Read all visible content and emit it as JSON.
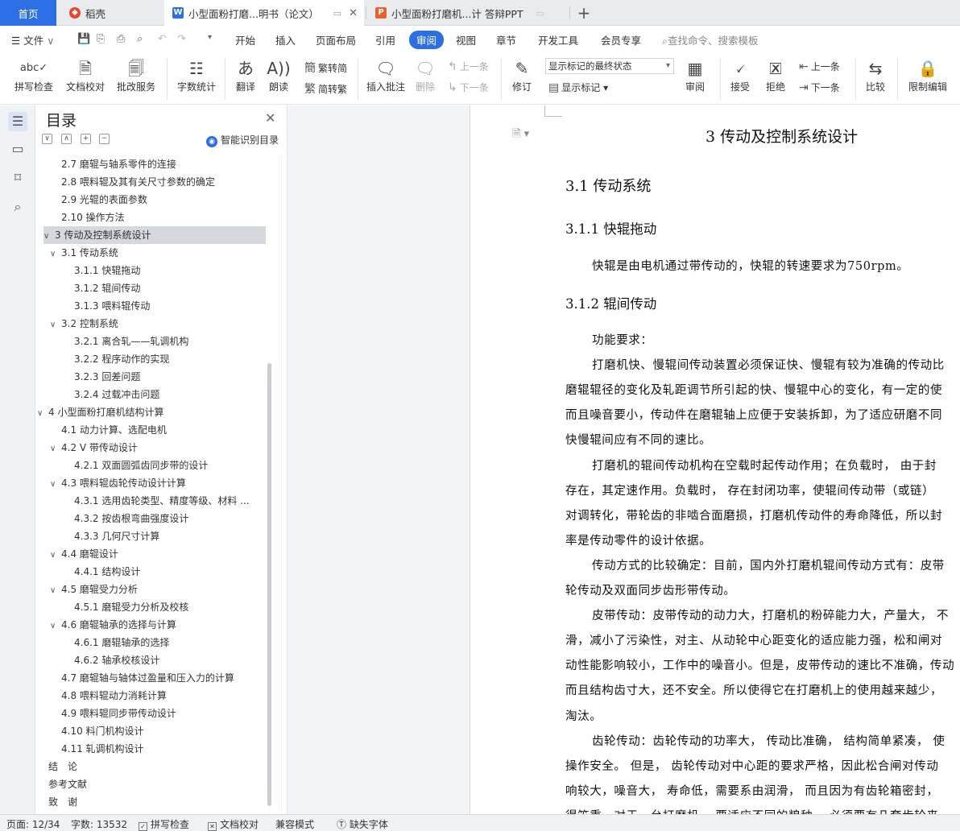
{
  "tabs": {
    "home": "首页",
    "docer": "稻壳",
    "doc_active": "小型面粉打磨...明书（论文）",
    "ppt": "小型面粉打磨机...计 答辩PPT",
    "plus": "+"
  },
  "menu": {
    "file": "文件",
    "items": [
      "开始",
      "插入",
      "页面布局",
      "引用",
      "审阅",
      "视图",
      "章节",
      "开发工具",
      "会员专享"
    ],
    "search": "查找命令、搜索模板"
  },
  "ribbon": {
    "spell": "拼写检查",
    "proofread": "文档校对",
    "annotate_service": "批改服务",
    "word_count": "字数统计",
    "translate": "翻译",
    "read_aloud": "朗读",
    "trad": "繁转简",
    "simp": "简转繁",
    "insert_comment": "插入批注",
    "delete": "删除",
    "prev": "上一条",
    "next": "下一条",
    "revise": "修订",
    "mark_state": "显示标记的最终状态",
    "show_marks": "显示标记",
    "review": "审阅",
    "accept": "接受",
    "reject": "拒绝",
    "prev2": "上一条",
    "next2": "下一条",
    "compare": "比较",
    "restrict": "限制编辑"
  },
  "toc": {
    "title": "目录",
    "smart": "智能识别目录",
    "items": [
      {
        "text": "2.7 磨辊与轴系零件的连接",
        "level": 2,
        "caret": ""
      },
      {
        "text": "2.8 喂料辊及其有关尺寸参数的确定",
        "level": 2,
        "caret": ""
      },
      {
        "text": "2.9 光辊的表面参数",
        "level": 2,
        "caret": ""
      },
      {
        "text": "2.10 操作方法",
        "level": 2,
        "caret": ""
      },
      {
        "text": "3 传动及控制系统设计",
        "level": 1,
        "caret": "∨",
        "sel": true
      },
      {
        "text": "3.1 传动系统",
        "level": 2,
        "caret": "∨"
      },
      {
        "text": "3.1.1 快辊拖动",
        "level": 3,
        "caret": ""
      },
      {
        "text": "3.1.2 辊间传动",
        "level": 3,
        "caret": ""
      },
      {
        "text": "3.1.3 喂料辊传动",
        "level": 3,
        "caret": ""
      },
      {
        "text": "3.2 控制系统",
        "level": 2,
        "caret": "∨"
      },
      {
        "text": "3.2.1 离合轧——轧调机构",
        "level": 3,
        "caret": ""
      },
      {
        "text": "3.2.2 程序动作的实现",
        "level": 3,
        "caret": ""
      },
      {
        "text": "3.2.3 回差问题",
        "level": 3,
        "caret": ""
      },
      {
        "text": "3.2.4 过载冲击问题",
        "level": 3,
        "caret": ""
      },
      {
        "text": "4 小型面粉打磨机结构计算",
        "level": 1,
        "caret": "∨"
      },
      {
        "text": "4.1 动力计算、选配电机",
        "level": 2,
        "caret": ""
      },
      {
        "text": "4.2 V 带传动设计",
        "level": 2,
        "caret": "∨"
      },
      {
        "text": "4.2.1 双面圆弧齿同步带的设计",
        "level": 3,
        "caret": ""
      },
      {
        "text": "4.3 喂料辊齿轮传动设计计算",
        "level": 2,
        "caret": "∨"
      },
      {
        "text": "4.3.1 选用齿轮类型、精度等级、材料 ...",
        "level": 3,
        "caret": ""
      },
      {
        "text": "4.3.2 按齿根弯曲强度设计",
        "level": 3,
        "caret": ""
      },
      {
        "text": "4.3.3 几何尺寸计算",
        "level": 3,
        "caret": ""
      },
      {
        "text": "4.4 磨辊设计",
        "level": 2,
        "caret": "∨"
      },
      {
        "text": "4.4.1 结构设计",
        "level": 3,
        "caret": ""
      },
      {
        "text": "4.5 磨辊受力分析",
        "level": 2,
        "caret": "∨"
      },
      {
        "text": "4.5.1 磨辊受力分析及校核",
        "level": 3,
        "caret": ""
      },
      {
        "text": "4.6 磨辊轴承的选择与计算",
        "level": 2,
        "caret": "∨"
      },
      {
        "text": "4.6.1 磨辊轴承的选择",
        "level": 3,
        "caret": ""
      },
      {
        "text": "4.6.2 轴承校核设计",
        "level": 3,
        "caret": ""
      },
      {
        "text": "4.7 磨辊轴与轴体过盈量和压入力的计算",
        "level": 2,
        "caret": ""
      },
      {
        "text": "4.8 喂料辊动力消耗计算",
        "level": 2,
        "caret": ""
      },
      {
        "text": "4.9 喂料辊同步带传动设计",
        "level": 2,
        "caret": ""
      },
      {
        "text": "4.10 料门机构设计",
        "level": 2,
        "caret": ""
      },
      {
        "text": "4.11 轧调机构设计",
        "level": 2,
        "caret": ""
      },
      {
        "text": "结　论",
        "level": 1,
        "caret": ""
      },
      {
        "text": "参考文献",
        "level": 1,
        "caret": ""
      },
      {
        "text": "致　谢",
        "level": 1,
        "caret": ""
      }
    ]
  },
  "doc": {
    "chapter_title": "3 传动及控制系统设计",
    "sec_31": "3.1 传动系统",
    "sec_311": "3.1.1 快辊拖动",
    "p_311": "快辊是由电机通过带传动的，快辊的转速要求为750rpm。",
    "sec_312": "3.1.2 辊间传动",
    "lines": [
      {
        "t": "功能要求：",
        "ind": true
      },
      {
        "t": "打磨机快、慢辊间传动装置必须保证快、慢辊有较为准确的传动比",
        "ind": true
      },
      {
        "t": "磨辊辊径的变化及轧距调节所引起的快、慢辊中心的变化，有一定的使",
        "ind": false
      },
      {
        "t": "而且噪音要小，传动件在磨辊轴上应便于安装拆卸，为了适应研磨不同",
        "ind": false
      },
      {
        "t": "快慢辊间应有不同的速比。",
        "ind": false
      },
      {
        "t": "打磨机的辊间传动机构在空载时起传动作用；在负载时，  由于封",
        "ind": true
      },
      {
        "t": "存在，其定速作用。负载时，  存在封闭功率，使辊间传动带（或链）",
        "ind": false
      },
      {
        "t": "对调转化，带轮齿的非啮合面磨损，打磨机传动件的寿命降低，所以封",
        "ind": false
      },
      {
        "t": "率是传动零件的设计依据。",
        "ind": false
      },
      {
        "t": "传动方式的比较确定：目前，国内外打磨机辊间传动方式有：皮带",
        "ind": true
      },
      {
        "t": "轮传动及双面同步齿形带传动。",
        "ind": false
      },
      {
        "t": "皮带传动：皮带传动的动力大，打磨机的粉碎能力大，产量大，  不",
        "ind": true
      },
      {
        "t": "滑，减小了污染性，对主、从动轮中心距变化的适应能力强，松和闸对",
        "ind": false
      },
      {
        "t": "动性能影响较小，工作中的噪音小。但是，皮带传动的速比不准确，传动",
        "ind": false
      },
      {
        "t": "而且结构齿寸大，还不安全。所以使得它在打磨机上的使用越来越少，",
        "ind": false
      },
      {
        "t": "淘汰。",
        "ind": false
      },
      {
        "t": "齿轮传动：齿轮传动的功率大，  传动比准确，  结构简单紧凑，  使",
        "ind": true
      },
      {
        "t": "操作安全。  但是，  齿轮传动对中心距的要求严格，因此松合闸对传动",
        "ind": false
      },
      {
        "t": "响较大，噪音大，  寿命低，需要系由润滑，  而且因为有齿轮箱密封，",
        "ind": false
      },
      {
        "t": "得笨重，对于一台打磨机，  要适应不同的粮种，  必须要有几套齿轮来",
        "ind": false
      }
    ]
  },
  "status": {
    "page": "页面: 12/34",
    "words": "字数: 13532",
    "spell": "拼写检查",
    "proof": "文档校对",
    "compat": "兼容模式",
    "missing_font": "缺失字体"
  }
}
